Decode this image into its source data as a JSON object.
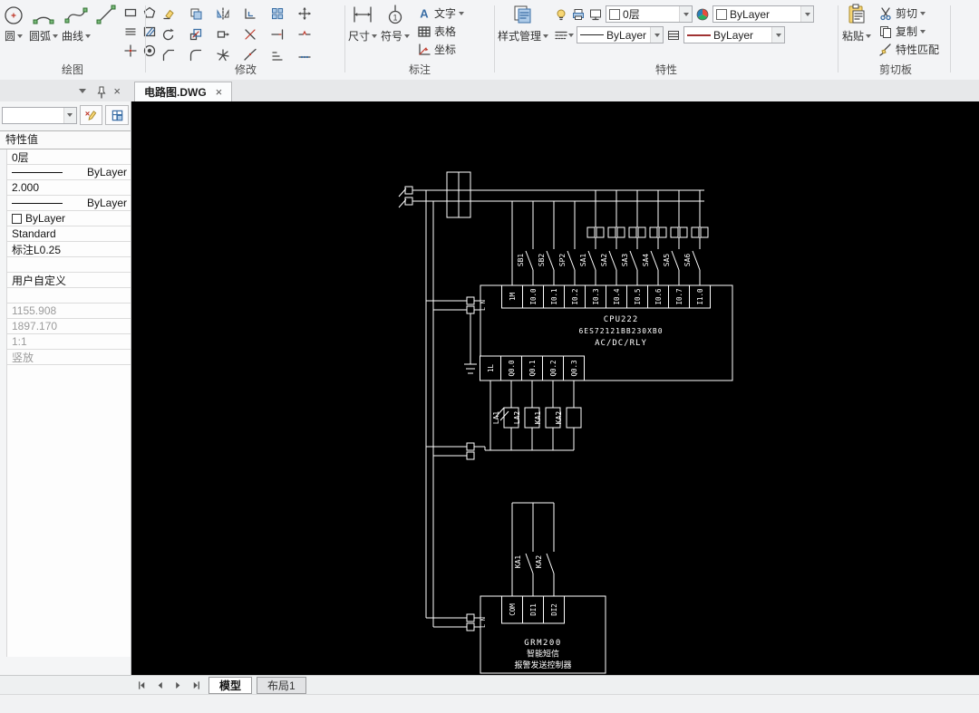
{
  "ribbon": {
    "draw": {
      "label": "绘图",
      "circle": "圆",
      "arc": "圆弧",
      "curve": "曲线",
      "small_icons": [
        "rectangle-icon",
        "polygon-icon",
        "multiline-icon",
        "hatch-icon",
        "point-icon",
        "donut-icon"
      ]
    },
    "modify": {
      "label": "修改",
      "icons": [
        "erase-icon",
        "copy-icon",
        "mirror-icon",
        "offset-icon",
        "array-icon",
        "move-icon",
        "rotate-icon",
        "scale-icon",
        "stretch-icon",
        "trim-icon",
        "extend-icon",
        "break-icon",
        "chamfer-icon",
        "fillet-icon",
        "explode-icon",
        "join-icon",
        "align-icon",
        "divide-icon"
      ]
    },
    "annotate": {
      "label": "标注",
      "dimension": "尺寸",
      "symbol": "符号",
      "text": "文字",
      "table": "表格",
      "coordinate": "坐标"
    },
    "properties": {
      "label": "特性",
      "style_manager": "样式管理",
      "layer": "0层",
      "color": "ByLayer",
      "linetype": "ByLayer",
      "lineweight": "ByLayer"
    },
    "clipboard": {
      "label": "剪切板",
      "paste": "粘贴",
      "cut": "剪切",
      "copy": "复制",
      "match": "特性匹配"
    }
  },
  "doc_tab": {
    "title": "电路图.DWG",
    "close": "×"
  },
  "side_panel": {
    "title": "特性值",
    "rows": [
      {
        "type": "text",
        "value": "0层"
      },
      {
        "type": "line",
        "value": "ByLayer"
      },
      {
        "type": "text",
        "value": "2.000"
      },
      {
        "type": "line",
        "value": "ByLayer"
      },
      {
        "type": "swatch",
        "value": "ByLayer"
      },
      {
        "type": "text",
        "value": "Standard"
      },
      {
        "type": "text",
        "value": "标注L0.25"
      },
      {
        "type": "empty",
        "value": ""
      },
      {
        "type": "text",
        "value": "用户自定义"
      },
      {
        "type": "empty",
        "value": ""
      },
      {
        "type": "gray",
        "value": "1155.908"
      },
      {
        "type": "gray",
        "value": "1897.170"
      },
      {
        "type": "gray",
        "value": "1:1"
      },
      {
        "type": "gray",
        "value": "竖放"
      }
    ]
  },
  "circuit": {
    "switch_labels": [
      "SB1",
      "SB2",
      "SP2",
      "SA1",
      "SA2",
      "SA3",
      "SA4",
      "SA5",
      "SA6"
    ],
    "input_labels": [
      "1M",
      "I0.0",
      "I0.1",
      "I0.2",
      "I0.3",
      "I0.4",
      "I0.5",
      "I0.6",
      "I0.7",
      "I1.0"
    ],
    "plc_lines": [
      "CPU222",
      "6ES72121BB230XB0",
      "AC/DC/RLY"
    ],
    "output_labels": [
      "1L",
      "Q0.0",
      "Q0.1",
      "Q0.2",
      "Q0.3"
    ],
    "relay_labels": [
      "LA1",
      "LA2",
      "KA1",
      "KA2"
    ],
    "grm_contact_labels": [
      "KA1",
      "KA2"
    ],
    "grm_terminal_labels": [
      "COM",
      "DI1",
      "DI2"
    ],
    "grm_text": [
      "GRM200",
      "智能短信",
      "报警发送控制器"
    ],
    "power_labels_top": "L N",
    "power_labels_bottom": "L N"
  },
  "bottom_bar": {
    "model_tab": "模型",
    "layout_tab": "布局1"
  },
  "colors": {
    "canvas_bg": "#000000",
    "wire": "#ffffff",
    "accent_blue": "#3a6ea5"
  }
}
